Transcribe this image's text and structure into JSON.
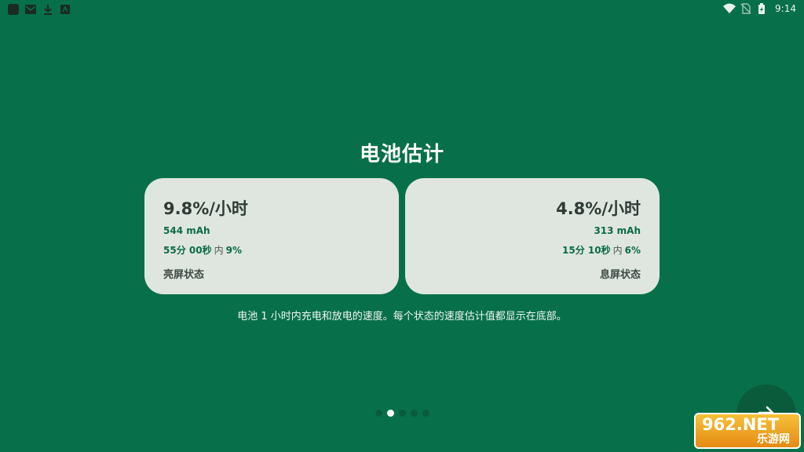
{
  "status_bar": {
    "time": "9:14",
    "left_icons": [
      "app-icon",
      "gmail-icon",
      "download-icon",
      "store-icon"
    ],
    "right_icons": [
      "wifi-icon",
      "no-sim-icon",
      "battery-icon"
    ]
  },
  "page": {
    "title": "电池估计",
    "description": "电池 1 小时内充电和放电的速度。每个状态的速度估计值都显示在底部。"
  },
  "cards": [
    {
      "rate": "9.8%/小时",
      "mah": "544 mAh",
      "duration": "55分 00秒",
      "within": "内",
      "percent": "9%",
      "state": "亮屏状态"
    },
    {
      "rate": "4.8%/小时",
      "mah": "313 mAh",
      "duration": "15分 10秒",
      "within": "内",
      "percent": "6%",
      "state": "息屏状态"
    }
  ],
  "pager": {
    "total": 5,
    "active_index": 1
  },
  "next_button": {
    "icon": "arrow-right-icon"
  },
  "watermark": {
    "top": "962.NET",
    "bottom": "乐游网"
  },
  "colors": {
    "background": "#07704a",
    "card": "#dfe6df",
    "accent": "#0c6b46"
  }
}
